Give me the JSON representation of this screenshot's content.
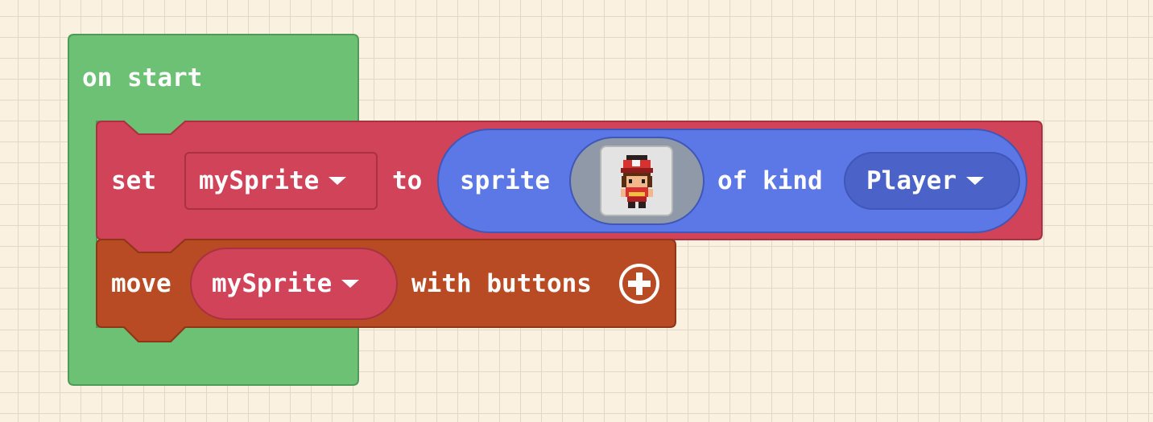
{
  "on_start": {
    "label": "on start",
    "color": "#6cc174"
  },
  "set_block": {
    "label": "set",
    "variable": "mySprite",
    "to_label": "to",
    "color": "#d04358"
  },
  "sprite_block": {
    "label": "sprite",
    "kind_label": "of kind",
    "kind_value": "Player",
    "image": "player-sprite-icon",
    "color": "#5c77e6"
  },
  "move_block": {
    "label": "move",
    "variable": "mySprite",
    "with_label": "with buttons",
    "color": "#b84a24"
  }
}
